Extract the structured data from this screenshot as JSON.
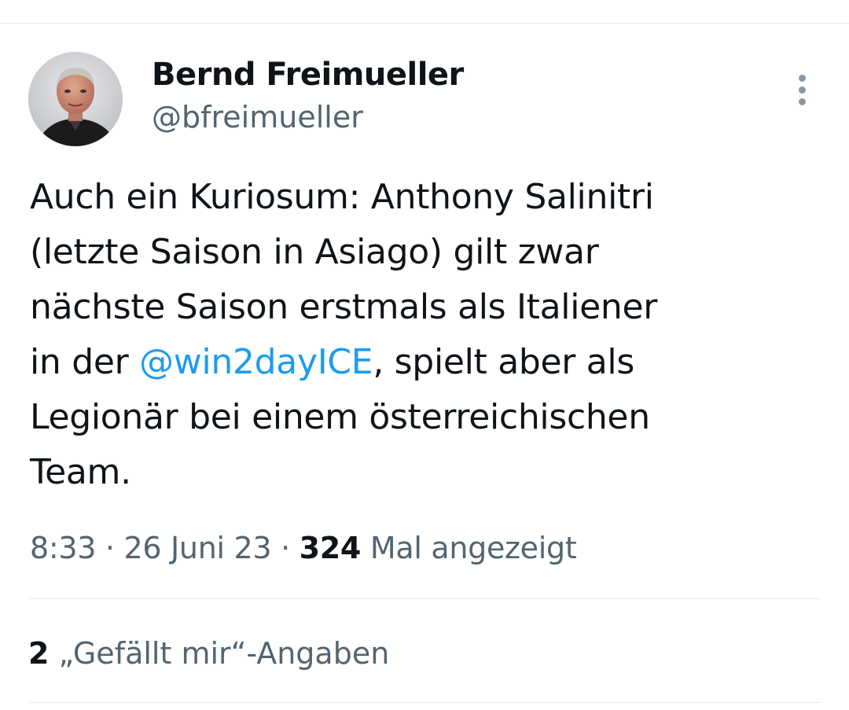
{
  "tweet": {
    "author": {
      "name": "Bernd Freimueller",
      "handle": "@bfreimueller",
      "avatar": "profile-photo"
    },
    "more_icon": "more-vertical-icon",
    "text_lines": [
      "Auch ein Kuriosum: Anthony Salinitri",
      "(letzte Saison in Asiago) gilt zwar",
      "nächste Saison erstmals als Italiener"
    ],
    "line4_before": "in der ",
    "mention": "@win2dayICE",
    "line4_after": ", spielt aber als",
    "text_lines_end": [
      "Legionär bei einem österreichischen",
      "Team."
    ],
    "time": "8:33",
    "date": "26 Juni 23",
    "separator": " · ",
    "views_count": "324",
    "views_label": " Mal angezeigt",
    "likes_count": "2",
    "likes_label": " „Gefällt mir“-Angaben",
    "colors": {
      "text": "#0f1419",
      "secondary": "#536471",
      "link": "#1d9bf0",
      "divider": "#e6e9eb"
    }
  }
}
